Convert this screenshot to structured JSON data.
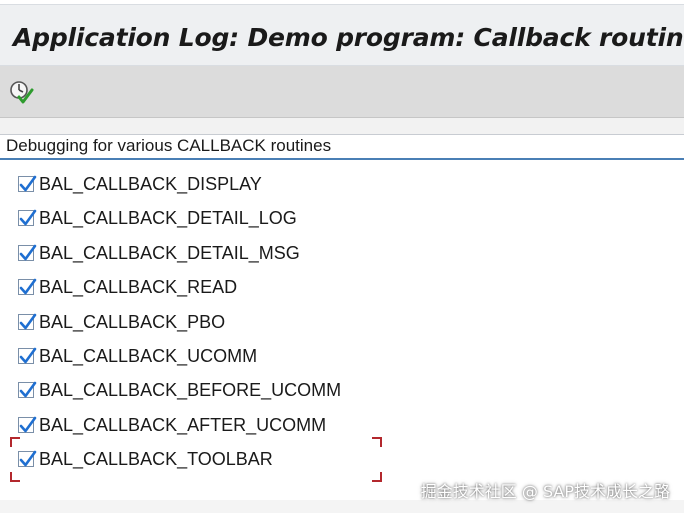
{
  "window": {
    "title": "Application Log: Demo program: Callback routines"
  },
  "toolbar": {
    "execute_icon": "execute-icon"
  },
  "group": {
    "title": "Debugging for various CALLBACK routines",
    "checkboxes": [
      {
        "label": "BAL_CALLBACK_DISPLAY",
        "checked": true
      },
      {
        "label": "BAL_CALLBACK_DETAIL_LOG",
        "checked": true
      },
      {
        "label": "BAL_CALLBACK_DETAIL_MSG",
        "checked": true
      },
      {
        "label": "BAL_CALLBACK_READ",
        "checked": true
      },
      {
        "label": "BAL_CALLBACK_PBO",
        "checked": true
      },
      {
        "label": "BAL_CALLBACK_UCOMM",
        "checked": true
      },
      {
        "label": "BAL_CALLBACK_BEFORE_UCOMM",
        "checked": true
      },
      {
        "label": "BAL_CALLBACK_AFTER_UCOMM",
        "checked": true
      },
      {
        "label": "BAL_CALLBACK_TOOLBAR",
        "checked": true,
        "focused": true
      }
    ]
  },
  "watermark": {
    "text": "掘金技术社区 @ SAP技术成长之路"
  },
  "colors": {
    "check": "#1f6fd1",
    "focus": "#b3282d",
    "group_line": "#4a7fb5"
  }
}
